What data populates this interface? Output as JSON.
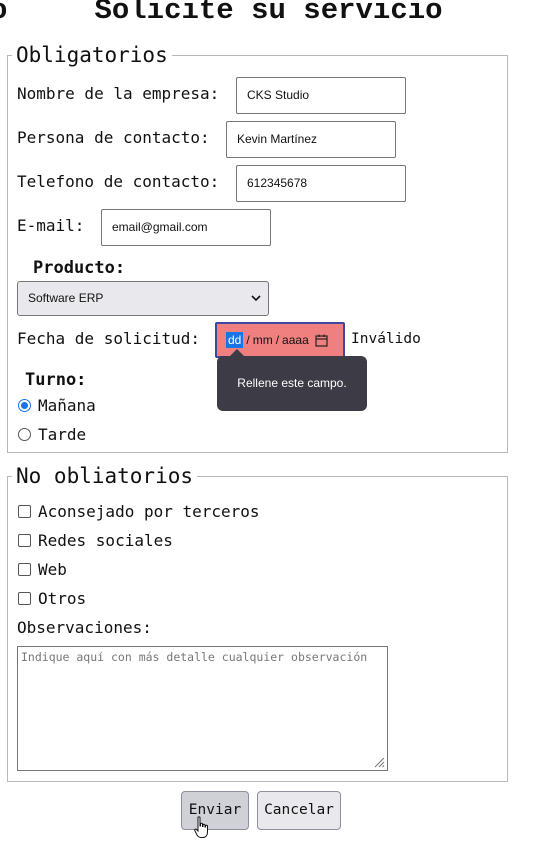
{
  "title_prefix": "o",
  "title": "Solicite su servicio",
  "obligatorios": {
    "legend": "Obligatorios",
    "empresa": {
      "label": "Nombre de la empresa:",
      "value": "CKS Studio"
    },
    "contacto": {
      "label": "Persona de contacto:",
      "value": "Kevin Martínez"
    },
    "telefono": {
      "label": "Telefono de contacto:",
      "value": "612345678"
    },
    "email": {
      "label": "E-mail:",
      "value": "email@gmail.com"
    },
    "producto": {
      "label": "Producto:",
      "value": "Software ERP"
    },
    "fecha": {
      "label": "Fecha de solicitud:",
      "dd": "dd",
      "sep1": "/",
      "mm": "mm",
      "sep2": "/",
      "aaaa": "aaaa",
      "status": "Inválido",
      "tooltip": "Rellene este campo."
    },
    "turno": {
      "label": "Turno:",
      "options": [
        "Mañana",
        "Tarde"
      ],
      "selected": "Mañana"
    }
  },
  "no_obligatorios": {
    "legend": "No obliatorios",
    "checkboxes": [
      "Aconsejado por terceros",
      "Redes sociales",
      "Web",
      "Otros"
    ],
    "observaciones_label": "Observaciones:",
    "observaciones_placeholder": "Indique aquí con más detalle cualquier observación"
  },
  "buttons": {
    "enviar": "Enviar",
    "cancelar": "Cancelar"
  },
  "colors": {
    "invalid_field": "#f08080",
    "accent": "#1a73e8",
    "tooltip_bg": "#3c3b46"
  },
  "icons": {
    "calendar": "calendar-icon",
    "chevron": "chevron-down-icon",
    "cursor": "hand-cursor-icon"
  }
}
